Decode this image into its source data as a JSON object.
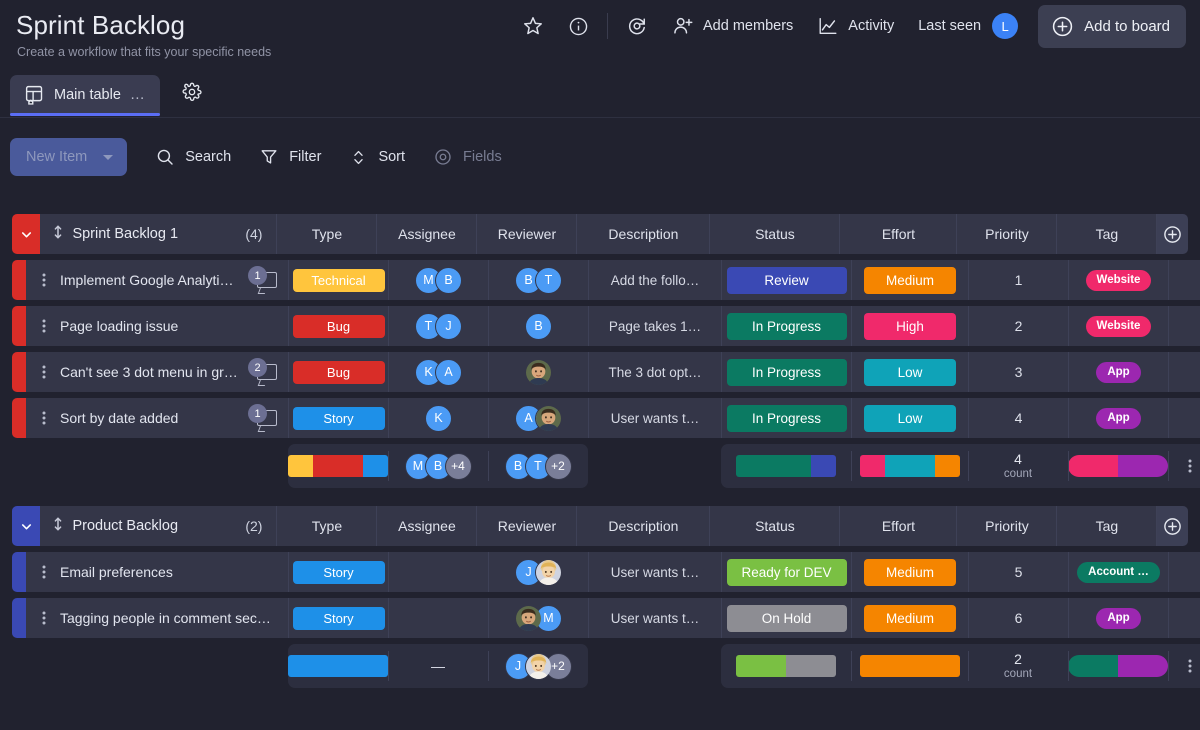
{
  "header": {
    "title": "Sprint Backlog",
    "subtitle": "Create a workflow that fits your specific needs",
    "actions": {
      "star": "star-icon",
      "info": "info-icon",
      "refresh": "activity-refresh-icon",
      "add_members": "Add members",
      "activity": "Activity",
      "last_seen": "Last seen",
      "last_seen_avatar": "L",
      "add_to_board": "Add to board"
    }
  },
  "tabs": {
    "main_table": "Main table",
    "more": "…",
    "settings_icon": "gear-icon"
  },
  "toolbar": {
    "new_item": "New Item",
    "search": "Search",
    "filter": "Filter",
    "sort": "Sort",
    "fields": "Fields"
  },
  "columns": [
    "Type",
    "Assignee",
    "Reviewer",
    "Description",
    "Status",
    "Effort",
    "Priority",
    "Tag"
  ],
  "colors": {
    "group1_accent": "#d92d28",
    "group2_accent": "#3a49b4",
    "type_technical": "#ffc53d",
    "type_bug": "#d92d28",
    "type_story": "#1e90e8",
    "status_review": "#3a49b4",
    "status_in_progress": "#0b7a62",
    "status_ready": "#7ac043",
    "status_on_hold": "#8d8d93",
    "effort_medium": "#f58500",
    "effort_high": "#f0296b",
    "effort_low": "#0fa3b8",
    "tag_website": "#f0296b",
    "tag_app": "#9c27b0",
    "tag_account": "#0b7a62",
    "avatar_blue": "#4b9bf5"
  },
  "groups": [
    {
      "name": "Sprint Backlog 1",
      "count": "(4)",
      "accent": "#d92d28",
      "rows": [
        {
          "title": "Implement Google Analyti…",
          "comments": "1",
          "type": {
            "label": "Technical",
            "color": "#ffc53d",
            "text": "#ffffff"
          },
          "assignee": [
            {
              "kind": "initial",
              "label": "M",
              "color": "#4b9bf5"
            },
            {
              "kind": "initial",
              "label": "B",
              "color": "#4b9bf5"
            }
          ],
          "reviewer": [
            {
              "kind": "initial",
              "label": "B",
              "color": "#4b9bf5"
            },
            {
              "kind": "initial",
              "label": "T",
              "color": "#4b9bf5"
            }
          ],
          "description": "Add the follo…",
          "status": {
            "label": "Review",
            "color": "#3a49b4"
          },
          "effort": {
            "label": "Medium",
            "color": "#f58500"
          },
          "priority": "1",
          "tag": {
            "label": "Website",
            "color": "#f0296b"
          }
        },
        {
          "title": "Page loading issue",
          "comments": "",
          "type": {
            "label": "Bug",
            "color": "#d92d28",
            "text": "#ffffff"
          },
          "assignee": [
            {
              "kind": "initial",
              "label": "T",
              "color": "#4b9bf5"
            },
            {
              "kind": "initial",
              "label": "J",
              "color": "#4b9bf5"
            }
          ],
          "reviewer": [
            {
              "kind": "initial",
              "label": "B",
              "color": "#4b9bf5"
            }
          ],
          "description": "Page takes 1…",
          "status": {
            "label": "In Progress",
            "color": "#0b7a62"
          },
          "effort": {
            "label": "High",
            "color": "#f0296b"
          },
          "priority": "2",
          "tag": {
            "label": "Website",
            "color": "#f0296b"
          }
        },
        {
          "title": "Can't see 3 dot menu in gr…",
          "comments": "2",
          "type": {
            "label": "Bug",
            "color": "#d92d28",
            "text": "#ffffff"
          },
          "assignee": [
            {
              "kind": "initial",
              "label": "K",
              "color": "#4b9bf5"
            },
            {
              "kind": "initial",
              "label": "A",
              "color": "#4b9bf5"
            }
          ],
          "reviewer": [
            {
              "kind": "photo",
              "label": "man",
              "color": "#6b5a44"
            }
          ],
          "description": "The 3 dot opt…",
          "status": {
            "label": "In Progress",
            "color": "#0b7a62"
          },
          "effort": {
            "label": "Low",
            "color": "#0fa3b8"
          },
          "priority": "3",
          "tag": {
            "label": "App",
            "color": "#9c27b0"
          }
        },
        {
          "title": "Sort by date added",
          "comments": "1",
          "type": {
            "label": "Story",
            "color": "#1e90e8",
            "text": "#ffffff"
          },
          "assignee": [
            {
              "kind": "initial",
              "label": "K",
              "color": "#4b9bf5"
            }
          ],
          "reviewer": [
            {
              "kind": "initial",
              "label": "A",
              "color": "#4b9bf5"
            },
            {
              "kind": "photo",
              "label": "man",
              "color": "#6b5a44"
            }
          ],
          "description": "User wants t…",
          "status": {
            "label": "In Progress",
            "color": "#0b7a62"
          },
          "effort": {
            "label": "Low",
            "color": "#0fa3b8"
          },
          "priority": "4",
          "tag": {
            "label": "App",
            "color": "#9c27b0"
          }
        }
      ],
      "summary": {
        "type_bar": [
          {
            "color": "#ffc53d",
            "pct": 25
          },
          {
            "color": "#d92d28",
            "pct": 50
          },
          {
            "color": "#1e90e8",
            "pct": 25
          }
        ],
        "assignee": {
          "avatars": [
            {
              "label": "M",
              "color": "#4b9bf5"
            },
            {
              "label": "B",
              "color": "#4b9bf5"
            }
          ],
          "more": "+4"
        },
        "reviewer": {
          "avatars": [
            {
              "label": "B",
              "color": "#4b9bf5"
            },
            {
              "label": "T",
              "color": "#4b9bf5"
            }
          ],
          "more": "+2"
        },
        "status_bar": [
          {
            "color": "#0b7a62",
            "pct": 75
          },
          {
            "color": "#3a49b4",
            "pct": 25
          }
        ],
        "effort_bar": [
          {
            "color": "#f0296b",
            "pct": 25
          },
          {
            "color": "#0fa3b8",
            "pct": 50
          },
          {
            "color": "#f58500",
            "pct": 25
          }
        ],
        "priority_count": "4",
        "priority_label": "count",
        "tag_bar": [
          {
            "color": "#f0296b",
            "pct": 50
          },
          {
            "color": "#9c27b0",
            "pct": 50
          }
        ]
      }
    },
    {
      "name": "Product Backlog",
      "count": "(2)",
      "accent": "#3a49b4",
      "rows": [
        {
          "title": "Email preferences",
          "comments": "",
          "type": {
            "label": "Story",
            "color": "#1e90e8",
            "text": "#ffffff"
          },
          "assignee": [],
          "reviewer": [
            {
              "kind": "initial",
              "label": "J",
              "color": "#4b9bf5"
            },
            {
              "kind": "photo",
              "label": "woman",
              "color": "#d9b98a"
            }
          ],
          "description": "User wants t…",
          "status": {
            "label": "Ready for DEV",
            "color": "#7ac043"
          },
          "effort": {
            "label": "Medium",
            "color": "#f58500"
          },
          "priority": "5",
          "tag": {
            "label": "Account …",
            "color": "#0b7a62"
          }
        },
        {
          "title": "Tagging people in comment sec…",
          "comments": "",
          "type": {
            "label": "Story",
            "color": "#1e90e8",
            "text": "#ffffff"
          },
          "assignee": [],
          "reviewer": [
            {
              "kind": "photo",
              "label": "man",
              "color": "#6b5a44"
            },
            {
              "kind": "initial",
              "label": "M",
              "color": "#4b9bf5"
            }
          ],
          "description": "User wants t…",
          "status": {
            "label": "On Hold",
            "color": "#8d8d93"
          },
          "effort": {
            "label": "Medium",
            "color": "#f58500"
          },
          "priority": "6",
          "tag": {
            "label": "App",
            "color": "#9c27b0"
          }
        }
      ],
      "summary": {
        "type_bar": [
          {
            "color": "#1e90e8",
            "pct": 100
          }
        ],
        "assignee": {
          "avatars": [],
          "more": "",
          "empty": "—"
        },
        "reviewer": {
          "avatars": [
            {
              "label": "J",
              "color": "#4b9bf5"
            },
            {
              "label": "woman",
              "color": "#d9b98a"
            }
          ],
          "more": "+2"
        },
        "status_bar": [
          {
            "color": "#7ac043",
            "pct": 50
          },
          {
            "color": "#8d8d93",
            "pct": 50
          }
        ],
        "effort_bar": [
          {
            "color": "#f58500",
            "pct": 100
          }
        ],
        "priority_count": "2",
        "priority_label": "count",
        "tag_bar": [
          {
            "color": "#0b7a62",
            "pct": 50
          },
          {
            "color": "#9c27b0",
            "pct": 50
          }
        ]
      }
    }
  ]
}
